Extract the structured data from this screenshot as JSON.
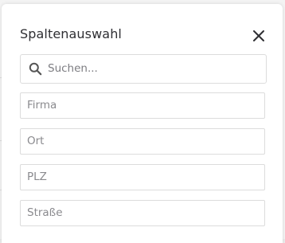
{
  "dialog": {
    "title": "Spaltenauswahl",
    "close_icon": "close-icon"
  },
  "search": {
    "placeholder": "Suchen...",
    "value": "",
    "icon": "search-icon"
  },
  "columns": [
    {
      "label": "Firma"
    },
    {
      "label": "Ort"
    },
    {
      "label": "PLZ"
    },
    {
      "label": "Straße"
    }
  ],
  "colors": {
    "title": "#2f2f33",
    "border": "#dcdcdc",
    "label": "#8a8a8e"
  }
}
